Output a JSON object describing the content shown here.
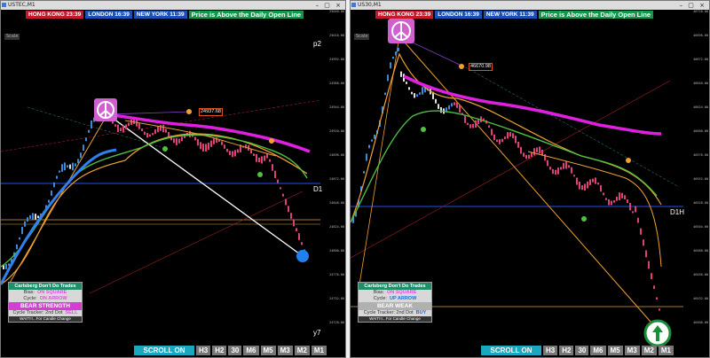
{
  "left_chart": {
    "window_title": "USTEC,M1",
    "sessions": {
      "hong_kong": "HONG KONG  23:39",
      "london": "LONDON  16:39",
      "new_york": "NEW YORK  11:39"
    },
    "banner": "Price is Above the Daily Open Line",
    "scale_label": "Scale",
    "price_tag": "24937.68",
    "right_label_top": "p2",
    "right_label_mid": "D1",
    "right_label_bottom": "y7",
    "info_panel": {
      "title": "Carlsberg Don't Do Trades",
      "bias_label": "Bias:",
      "bias_value": "ON SQUARE",
      "cycle_label": "Cycle:",
      "cycle_value": "ON ARROW",
      "strength": "BEAR STRENGTH",
      "tracker_label": "Cycle Tracker: 2nd Dot",
      "tracker_value": "SELL",
      "wait_text": "WAIT!!!...For Candle Change"
    },
    "axis_labels": [
      "25040.00",
      "25016.00",
      "24992.00",
      "24968.00",
      "24944.00",
      "24920.00",
      "24896.00",
      "24872.00",
      "24848.00",
      "24824.00",
      "24800.00",
      "24776.00",
      "24752.00",
      "24728.00"
    ],
    "colors": {
      "background": "#000000",
      "candles": "#e0407a",
      "ma_magenta": "#e020e0",
      "ma_orange": "#f0a030",
      "ma_green": "#50c040",
      "ma_blue": "#3080f0",
      "daily_line": "#1e40c0",
      "open_line": "#d4a050"
    }
  },
  "right_chart": {
    "window_title": "US30,M1",
    "sessions": {
      "hong_kong": "HONG KONG  23:39",
      "london": "LONDON  16:39",
      "new_york": "NEW YORK  11:39"
    },
    "banner": "Price is Above the Daily Open Line",
    "scale_label": "Scale",
    "price_tag": "46670.98",
    "right_label_mid": "D1H",
    "info_panel": {
      "title": "Carlsberg Don't Do Trades",
      "bias_label": "Bias:",
      "bias_value": "ON SQUARE",
      "cycle_label": "Cycle:",
      "cycle_value": "UP ARROW",
      "strength": "BEAR WEAK",
      "tracker_label": "Cycle Tracker: 2nd Dot",
      "tracker_value": "BUY",
      "wait_text": "WAIT!!!...For Candle Change"
    },
    "axis_labels": [
      "46720.00",
      "46696.00",
      "46672.00",
      "46648.00",
      "46624.00",
      "46600.00",
      "46576.00",
      "46552.00",
      "46528.00",
      "46504.00",
      "46480.00",
      "46456.00",
      "46432.00",
      "46408.00"
    ]
  },
  "toolbar": {
    "scroll_label": "SCROLL ON",
    "timeframes": [
      "H3",
      "H2",
      "30",
      "M6",
      "M5",
      "M3",
      "M2",
      "M1"
    ]
  },
  "icons": [
    "peace-icon",
    "peace-icon",
    "down-arrow-circle-icon",
    "up-arrow-circle-icon"
  ]
}
